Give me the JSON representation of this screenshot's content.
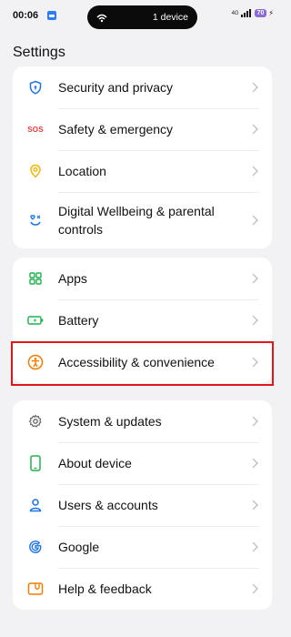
{
  "status_bar": {
    "time": "00:06",
    "pill_text": "1 device",
    "network_small": "4G",
    "battery": "70"
  },
  "header": {
    "title": "Settings"
  },
  "cards": [
    {
      "items": [
        {
          "label": "Security and privacy",
          "icon": "shield-icon",
          "color": "#1a73e8"
        },
        {
          "label": "Safety & emergency",
          "icon": "sos-icon",
          "icon_text": "SOS",
          "color": "#e53935"
        },
        {
          "label": "Location",
          "icon": "location-pin-icon",
          "color": "#f4b400"
        },
        {
          "label": "Digital Wellbeing & parental controls",
          "icon": "wellbeing-icon",
          "color": "#1a73e8"
        }
      ]
    },
    {
      "items": [
        {
          "label": "Apps",
          "icon": "apps-grid-icon",
          "color": "#1fb24a"
        },
        {
          "label": "Battery",
          "icon": "battery-icon",
          "color": "#1fb24a"
        },
        {
          "label": "Accessibility & convenience",
          "icon": "accessibility-icon",
          "color": "#f57c00"
        }
      ]
    },
    {
      "items": [
        {
          "label": "System & updates",
          "icon": "gear-icon",
          "color": "#666666"
        },
        {
          "label": "About device",
          "icon": "phone-icon",
          "color": "#1fb24a"
        },
        {
          "label": "Users & accounts",
          "icon": "user-icon",
          "color": "#1a73e8"
        },
        {
          "label": "Google",
          "icon": "google-icon",
          "color": "#1a73e8"
        },
        {
          "label": "Help & feedback",
          "icon": "help-feedback-icon",
          "color": "#f57c00"
        }
      ]
    }
  ]
}
